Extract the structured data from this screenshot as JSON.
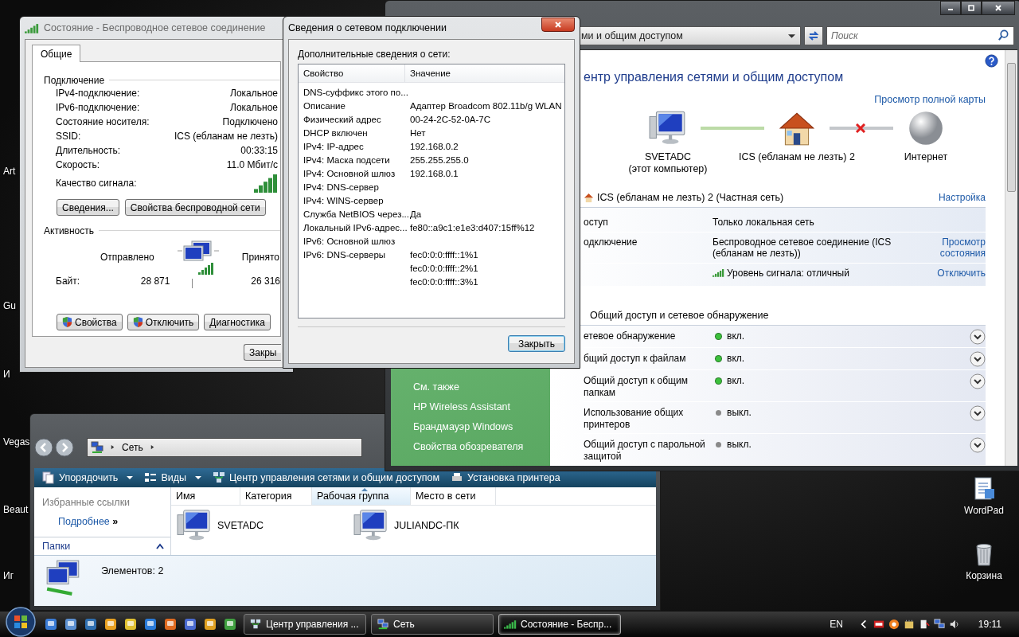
{
  "desktop_icons_left": [
    {
      "label": "Art"
    },
    {
      "label": "Gu"
    },
    {
      "label": "И"
    },
    {
      "label": "Vegas"
    },
    {
      "label": "Beaut"
    },
    {
      "label": "Иг"
    }
  ],
  "desktop_icons_right": [
    {
      "label": "WordPad",
      "kind": "document"
    },
    {
      "label": "Корзина",
      "kind": "bin"
    }
  ],
  "status_window": {
    "title": "Состояние - Беспроводное сетевое соединение",
    "tabs": [
      {
        "label": "Общие",
        "selected": true
      }
    ],
    "connection": {
      "heading": "Подключение",
      "rows": [
        {
          "label": "IPv4-подключение:",
          "value": "Локальное"
        },
        {
          "label": "IPv6-подключение:",
          "value": "Локальное"
        },
        {
          "label": "Состояние носителя:",
          "value": "Подключено"
        },
        {
          "label": "SSID:",
          "value": "ICS (ебланам не лезть)"
        },
        {
          "label": "Длительность:",
          "value": "00:33:15"
        },
        {
          "label": "Скорость:",
          "value": "11.0 Мбит/с"
        }
      ],
      "signal_label": "Качество сигнала:"
    },
    "buttons": [
      "Сведения...",
      "Свойства беспроводной сети"
    ],
    "activity": {
      "heading": "Активность",
      "sent_label": "Отправлено",
      "received_label": "Принято",
      "bytes_label": "Байт:",
      "bytes_sent": "28 871",
      "bytes_received": "26 316"
    },
    "bottom_buttons": [
      {
        "label": "Свойства",
        "shield": true
      },
      {
        "label": "Отключить",
        "shield": true
      },
      {
        "label": "Диагностика",
        "shield": false
      }
    ],
    "close_button": "Закры"
  },
  "details_dialog": {
    "title": "Сведения о сетевом подключении",
    "caption": "Дополнительные сведения о сети:",
    "columns": [
      "Свойство",
      "Значение"
    ],
    "rows": [
      {
        "property": "DNS-суффикс этого по..."
      },
      {
        "property": "Описание",
        "value": "Адаптер Broadcom 802.11b/g WLAN"
      },
      {
        "property": "Физический адрес",
        "value": "00-24-2C-52-0A-7C"
      },
      {
        "property": "DHCP включен",
        "value": "Нет"
      },
      {
        "property": "IPv4: IP-адрес",
        "value": "192.168.0.2"
      },
      {
        "property": "IPv4: Маска подсети",
        "value": "255.255.255.0"
      },
      {
        "property": "IPv4: Основной шлюз",
        "value": "192.168.0.1"
      },
      {
        "property": "IPv4: DNS-сервер"
      },
      {
        "property": "IPv4: WINS-сервер"
      },
      {
        "property": "Служба NetBIOS через...",
        "value": "Да"
      },
      {
        "property": "Локальный IPv6-адрес...",
        "value": "fe80::a9c1:e1e3:d407:15ff%12"
      },
      {
        "property": "IPv6: Основной шлюз"
      },
      {
        "property": "IPv6: DNS-серверы",
        "value": "fec0:0:0:ffff::1%1"
      },
      {
        "value": "fec0:0:0:ffff::2%1"
      },
      {
        "value": "fec0:0:0:ffff::3%1"
      }
    ],
    "close_button": "Закрыть"
  },
  "network_center": {
    "address": "ми и общим доступом",
    "search": {
      "placeholder": "Поиск"
    },
    "heading": "ентр управления сетями и общим доступом",
    "map_link": "Просмотр полной карты",
    "map_nodes": [
      {
        "label": "SVETADC",
        "sublabel": "(этот компьютер)",
        "kind": "computer"
      },
      {
        "label": "ICS (ебланам не лезть) 2",
        "kind": "house"
      },
      {
        "label": "Интернет",
        "kind": "globe"
      }
    ],
    "map_links": [
      {
        "connected": true
      },
      {
        "connected": false
      }
    ],
    "network": {
      "name": "ICS (ебланам не лезть) 2 (Частная сеть)",
      "action": "Настройка",
      "rows": [
        {
          "label": "оступ",
          "value": "Только локальная сеть"
        },
        {
          "label": "одключение",
          "value": "Беспроводное сетевое соединение (ICS (ебланам не лезть))",
          "action": "Просмотр состояния"
        },
        {
          "value": "Уровень сигнала: отличный",
          "action": "Отключить",
          "kind": "signal"
        }
      ]
    },
    "sharing": {
      "heading": "Общий доступ и сетевое обнаружение",
      "rows": [
        {
          "label": "етевое обнаружение",
          "status": "вкл.",
          "on": true
        },
        {
          "label": "бщий доступ к файлам",
          "status": "вкл.",
          "on": true
        },
        {
          "label": "Общий доступ к общим папкам",
          "status": "вкл.",
          "on": true
        },
        {
          "label": "Использование общих принтеров",
          "status": "выкл.",
          "on": false
        },
        {
          "label": "Общий доступ с парольной защитой",
          "status": "выкл.",
          "on": false
        }
      ]
    },
    "see_also": {
      "heading": "См. также",
      "links": [
        "HP Wireless Assistant",
        "Брандмауэр Windows",
        "Свойства обозревателя"
      ]
    }
  },
  "explorer": {
    "address": "Сеть",
    "toolbar": [
      {
        "label": "Упорядочить",
        "kind": "organize",
        "dropdown": true
      },
      {
        "label": "Виды",
        "kind": "views",
        "dropdown": true
      },
      {
        "label": "Центр управления сетями и общим доступом",
        "kind": "network",
        "dropdown": false
      },
      {
        "label": "Установка принтера",
        "kind": "printer",
        "dropdown": false
      }
    ],
    "favorites_heading": "Избранные ссылки",
    "more_link": "Подробнее",
    "more_glyph": "»",
    "folders": "Папки",
    "columns": [
      {
        "label": "Имя",
        "sorted": false
      },
      {
        "label": "Категория",
        "sorted": false
      },
      {
        "label": "Рабочая группа",
        "sorted": true
      },
      {
        "label": "Место в сети",
        "sorted": false
      }
    ],
    "items": [
      "SVETADC",
      "JULIANDC-ПК"
    ],
    "status": "Элементов: 2"
  },
  "taskbar": {
    "tasks": [
      {
        "label": "Центр управления ...",
        "kind": "network",
        "selected": false
      },
      {
        "label": "Сеть",
        "kind": "folder",
        "selected": false
      },
      {
        "label": "Состояние - Беспр...",
        "kind": "signal",
        "selected": true
      }
    ],
    "language": "EN",
    "clock": "19:11"
  }
}
